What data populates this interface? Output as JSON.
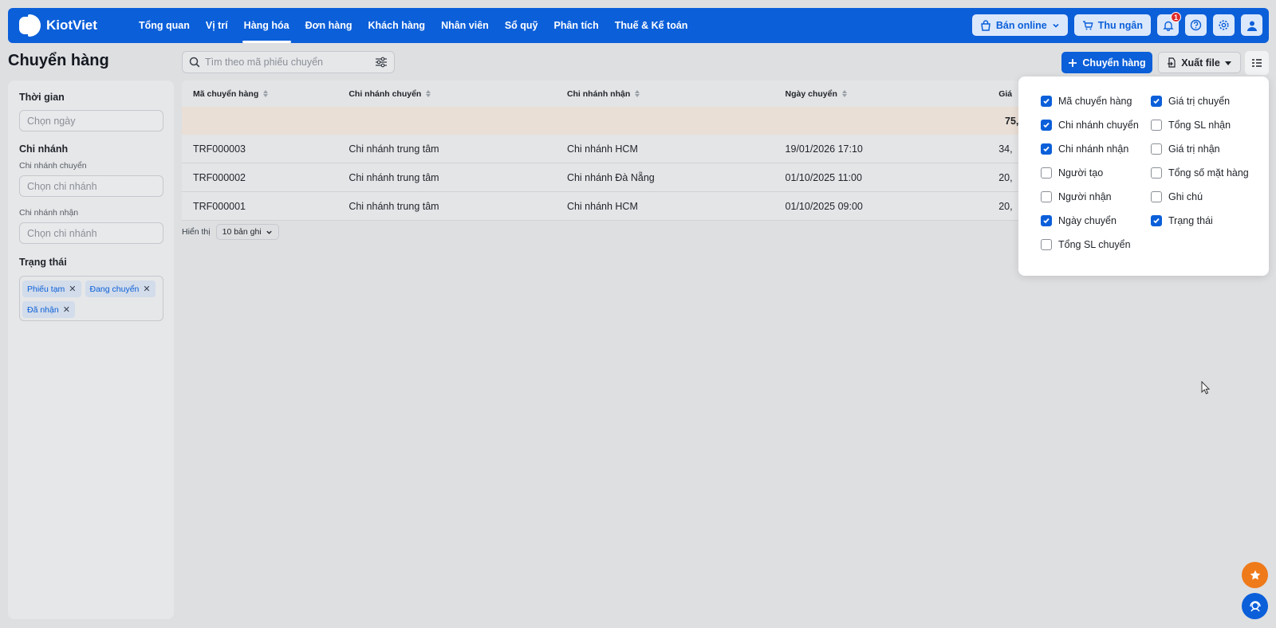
{
  "app": {
    "name": "KiotViet"
  },
  "nav": {
    "items": [
      {
        "label": "Tổng quan",
        "active": false
      },
      {
        "label": "Vị trí",
        "active": false
      },
      {
        "label": "Hàng hóa",
        "active": true
      },
      {
        "label": "Đơn hàng",
        "active": false
      },
      {
        "label": "Khách hàng",
        "active": false
      },
      {
        "label": "Nhân viên",
        "active": false
      },
      {
        "label": "Sổ quỹ",
        "active": false
      },
      {
        "label": "Phân tích",
        "active": false
      },
      {
        "label": "Thuế & Kế toán",
        "active": false
      }
    ],
    "online_sale": "Bán online",
    "cashier": "Thu ngân",
    "notification_count": "1"
  },
  "page": {
    "title": "Chuyển hàng",
    "search_placeholder": "Tìm theo mã phiếu chuyển",
    "add_button": "Chuyển hàng",
    "export_button": "Xuất file"
  },
  "filters": {
    "time_title": "Thời gian",
    "time_placeholder": "Chọn ngày",
    "branch_title": "Chi nhánh",
    "from_branch_label": "Chi nhánh chuyển",
    "from_branch_placeholder": "Chọn chi nhánh",
    "to_branch_label": "Chi nhánh nhận",
    "to_branch_placeholder": "Chọn chi nhánh",
    "status_title": "Trạng thái",
    "status_tags": [
      "Phiếu tạm",
      "Đang chuyển",
      "Đã nhận"
    ]
  },
  "table": {
    "columns": [
      "Mã chuyển hàng",
      "Chi nhánh chuyển",
      "Chi nhánh nhận",
      "Ngày chuyển",
      "Giá"
    ],
    "summary_value": "75,",
    "rows": [
      {
        "code": "TRF000003",
        "from": "Chi nhánh trung tâm",
        "to": "Chi nhánh HCM",
        "date": "19/01/2026 17:10",
        "value": "34,"
      },
      {
        "code": "TRF000002",
        "from": "Chi nhánh trung tâm",
        "to": "Chi nhánh Đà Nẵng",
        "date": "01/10/2025 11:00",
        "value": "20,"
      },
      {
        "code": "TRF000001",
        "from": "Chi nhánh trung tâm",
        "to": "Chi nhánh HCM",
        "date": "01/10/2025 09:00",
        "value": "20,"
      }
    ],
    "pager_label": "Hiển thị",
    "pager_value": "10 bản ghi"
  },
  "column_picker": {
    "options": [
      {
        "label": "Mã chuyển hàng",
        "checked": true
      },
      {
        "label": "Giá trị chuyển",
        "checked": true
      },
      {
        "label": "Chi nhánh chuyển",
        "checked": true
      },
      {
        "label": "Tổng SL nhận",
        "checked": false
      },
      {
        "label": "Chi nhánh nhận",
        "checked": true
      },
      {
        "label": "Giá trị nhận",
        "checked": false
      },
      {
        "label": "Người tạo",
        "checked": false
      },
      {
        "label": "Tổng số mặt hàng",
        "checked": false
      },
      {
        "label": "Người nhận",
        "checked": false
      },
      {
        "label": "Ghi chú",
        "checked": false
      },
      {
        "label": "Ngày chuyển",
        "checked": true
      },
      {
        "label": "Trạng thái",
        "checked": true
      },
      {
        "label": "Tổng SL chuyển",
        "checked": false
      }
    ]
  },
  "colors": {
    "primary": "#0b5fd9",
    "fab_star": "#ef7a1a"
  }
}
